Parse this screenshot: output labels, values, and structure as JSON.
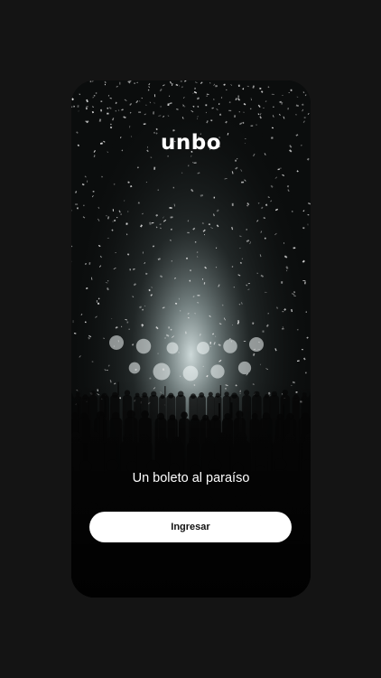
{
  "app": {
    "logo_text": "unbo",
    "tagline": "Un boleto al paraíso",
    "login_button_label": "Ingresar"
  },
  "colors": {
    "page_background": "#141414",
    "button_background": "#ffffff",
    "button_text": "#111111",
    "text": "#ffffff"
  },
  "background_image": "concert-crowd-confetti-photo"
}
